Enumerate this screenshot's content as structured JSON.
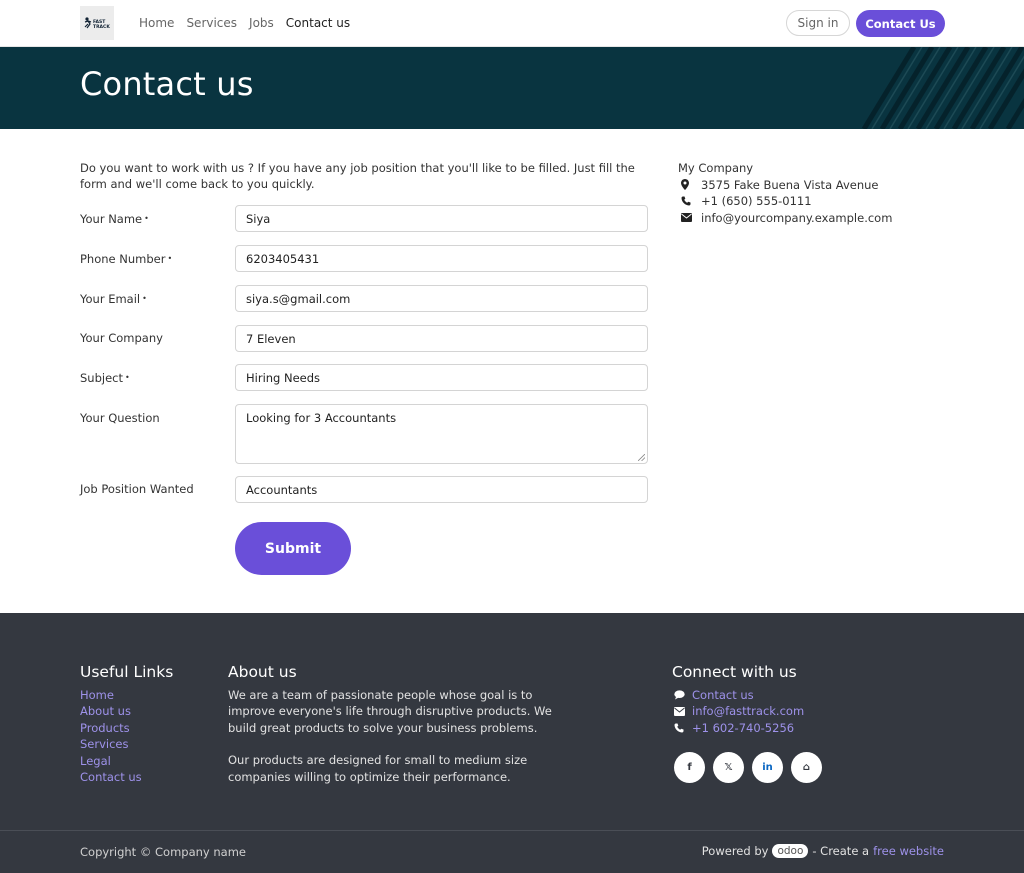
{
  "header": {
    "logo_text": "FAST TRACK",
    "nav": [
      {
        "label": "Home"
      },
      {
        "label": "Services"
      },
      {
        "label": "Jobs"
      },
      {
        "label": "Contact us"
      }
    ],
    "signin_label": "Sign in",
    "contact_label": "Contact Us"
  },
  "banner": {
    "title": "Contact us",
    "background_color": "#093440"
  },
  "form": {
    "intro": "Do you want to work with us ? If you have any job position that you'll like to be filled. Just fill the form and we'll come back to you quickly.",
    "required_marker": "•",
    "fields": [
      {
        "label": "Your Name",
        "value": "Siya",
        "required": true
      },
      {
        "label": "Phone Number",
        "value": "6203405431",
        "required": true
      },
      {
        "label": "Your Email",
        "value": "siya.s@gmail.com",
        "required": true
      },
      {
        "label": "Your Company",
        "value": "7 Eleven",
        "required": false
      },
      {
        "label": "Subject",
        "value": "Hiring Needs",
        "required": true
      },
      {
        "label": "Your Question",
        "value": "Looking for 3 Accountants",
        "required": false
      },
      {
        "label": "Job Position Wanted",
        "value": "Accountants",
        "required": false
      }
    ],
    "submit_label": "Submit",
    "accent_color": "#6a4fd9"
  },
  "company": {
    "name": "My Company",
    "address": "3575 Fake Buena Vista Avenue",
    "phone": "+1 (650) 555-0111",
    "email": "info@yourcompany.example.com"
  },
  "footer": {
    "useful_links_title": "Useful Links",
    "useful_links": [
      "Home",
      "About us",
      "Products",
      "Services",
      "Legal",
      "Contact us"
    ],
    "about_title": "About us",
    "about_p1": "We are a team of passionate people whose goal is to improve everyone's life through disruptive products. We build great products to solve your business problems.",
    "about_p2": "Our products are designed for small to medium size companies willing to optimize their performance.",
    "connect_title": "Connect with us",
    "connect_contact": "Contact us",
    "connect_email": "info@fasttrack.com",
    "connect_phone": "+1 602-740-5256",
    "social": [
      {
        "icon": "facebook-icon",
        "glyph": "f"
      },
      {
        "icon": "x-icon",
        "glyph": "𝕏"
      },
      {
        "icon": "linkedin-icon",
        "glyph": "in"
      },
      {
        "icon": "home-icon",
        "glyph": "⌂"
      }
    ],
    "copyright": "Copyright © Company name",
    "powered_by": "Powered by",
    "odoo": "odoo",
    "create_text": "- Create a",
    "free_website": "free website",
    "background_color": "#343840"
  }
}
